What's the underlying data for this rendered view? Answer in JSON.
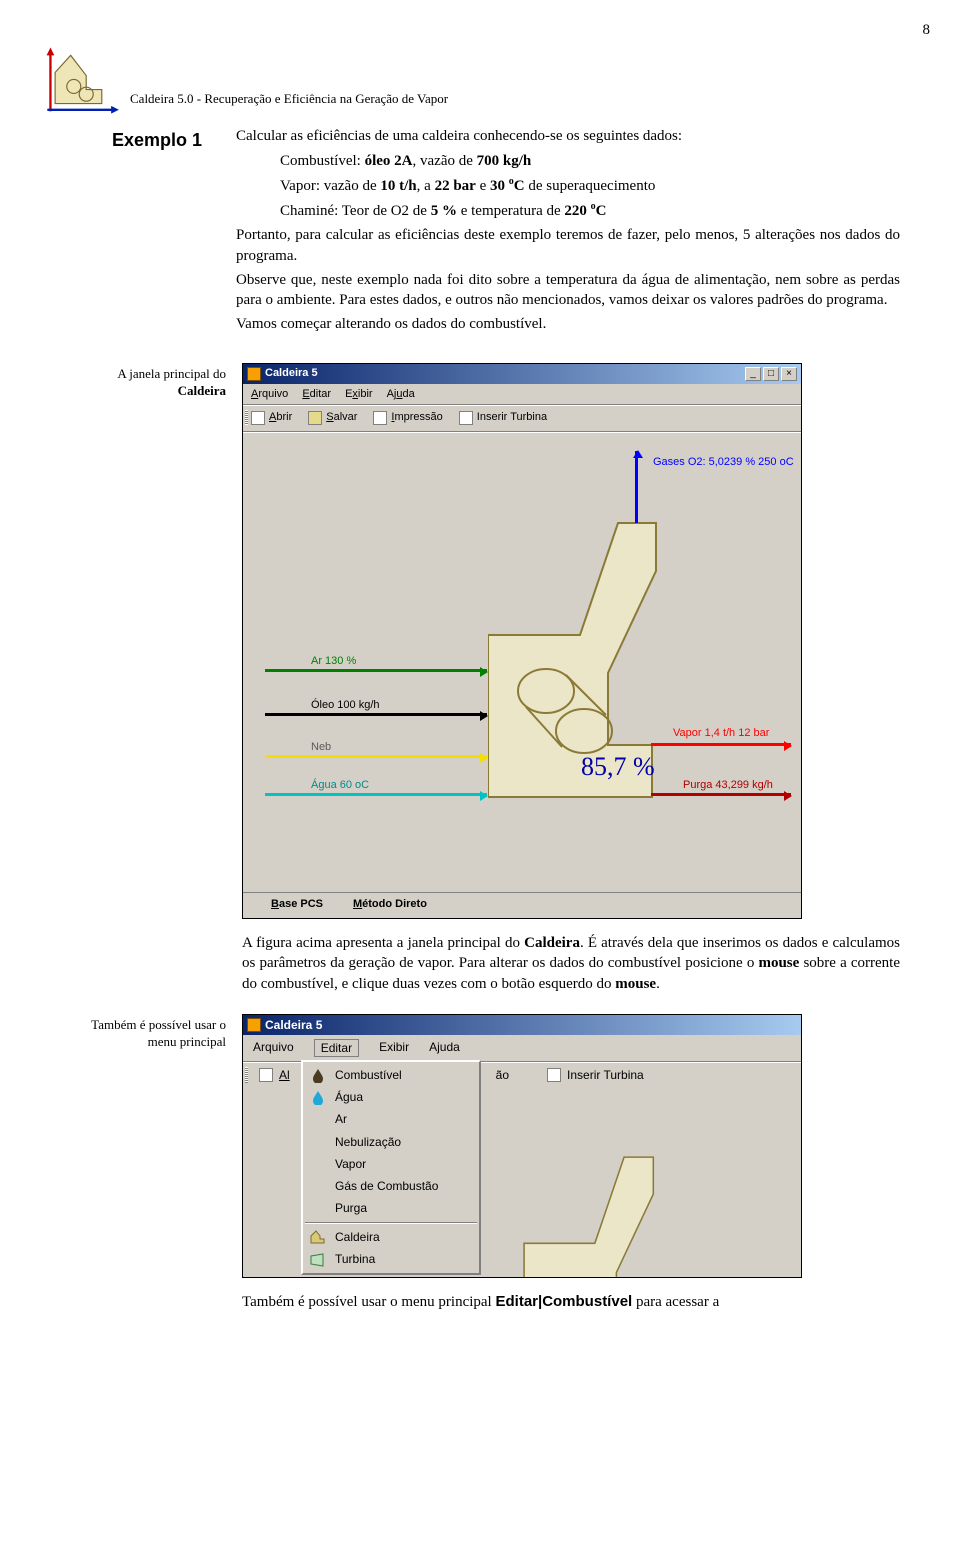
{
  "page_number": "8",
  "header": {
    "text": "Caldeira 5.0 - Recuperação e Eficiência na Geração de Vapor"
  },
  "example": {
    "label": "Exemplo 1",
    "intro": "Calcular as eficiências de uma caldeira conhecendo-se os seguintes dados:",
    "line_comb_a": "Combustível: ",
    "line_comb_b": "óleo 2A",
    "line_comb_c": ", vazão de ",
    "line_comb_d": "700 kg/h",
    "line_vapor_a": "Vapor: vazão de ",
    "line_vapor_b": "10 t/h",
    "line_vapor_c": ", a ",
    "line_vapor_d": "22 bar",
    "line_vapor_e": " e ",
    "line_vapor_f": "30 ",
    "line_vapor_g": "C",
    "line_vapor_h": "  de superaquecimento",
    "line_cham_a": "Chaminé:  Teor de O2 de ",
    "line_cham_b": "5 %",
    "line_cham_c": " e temperatura de ",
    "line_cham_d": "220 ",
    "line_cham_e": "C",
    "p1": "Portanto, para calcular as eficiências deste exemplo teremos de fazer, pelo menos, 5 alterações nos dados do programa.",
    "p2": "Observe que, neste exemplo nada foi dito sobre a temperatura da água de alimentação, nem sobre as perdas para o ambiente. Para estes dados, e outros não mencionados,  vamos deixar os valores padrões do programa.",
    "p3": "Vamos começar alterando os dados do combustível."
  },
  "note1_a": "A  janela principal do",
  "note1_b": "Caldeira",
  "shot1": {
    "title": "Caldeira 5",
    "menu": {
      "arquivo": "Arquivo",
      "editar": "Editar",
      "exibir": "Exibir",
      "ajuda": "Ajuda"
    },
    "toolbar": {
      "abrir": "Abrir",
      "salvar": "Salvar",
      "impressao": "Impressão",
      "turbina": "Inserir Turbina"
    },
    "labels": {
      "gases": "Gases O2: 5,0239 % 250 oC",
      "vapor": "Vapor 1,4 t/h 12 bar",
      "ar": "Ar 130 %",
      "oleo": "Óleo 100 kg/h",
      "neb": "Neb",
      "agua": "Água 60 oC",
      "purga": "Purga 43,299 kg/h",
      "pct": "85,7 %"
    },
    "status": {
      "base": "Base PCS",
      "metodo": "Método Direto"
    }
  },
  "after1_a": "A figura acima apresenta a janela principal do ",
  "after1_b": "Caldeira",
  "after1_c": ". É através dela que inserimos os dados e calculamos os parâmetros da geração de vapor. Para alterar os dados do combustível posicione o ",
  "after1_d": "mouse",
  "after1_e": " sobre a corrente do combustível, e clique duas vezes com o botão esquerdo do ",
  "after1_f": "mouse",
  "after1_g": ".",
  "note2_a": "Também é possível usar o",
  "note2_b": "menu principal",
  "shot2": {
    "title": "Caldeira 5",
    "menu": {
      "arquivo": "Arquivo",
      "editar": "Editar",
      "exibir": "Exibir",
      "ajuda": "Ajuda"
    },
    "tb_al": "Al",
    "tb_ao": "ão",
    "tb_ins": "Inserir Turbina",
    "items": {
      "comb": "Combustível",
      "agua": "Água",
      "ar": "Ar",
      "neb": "Nebulização",
      "vapor": "Vapor",
      "gas": "Gás de Combustão",
      "purga": "Purga",
      "cald": "Caldeira",
      "turb": "Turbina"
    }
  },
  "footer_a": "Também é possível usar o menu principal ",
  "footer_b": "Editar|Combustível",
  "footer_c": " para acessar a"
}
